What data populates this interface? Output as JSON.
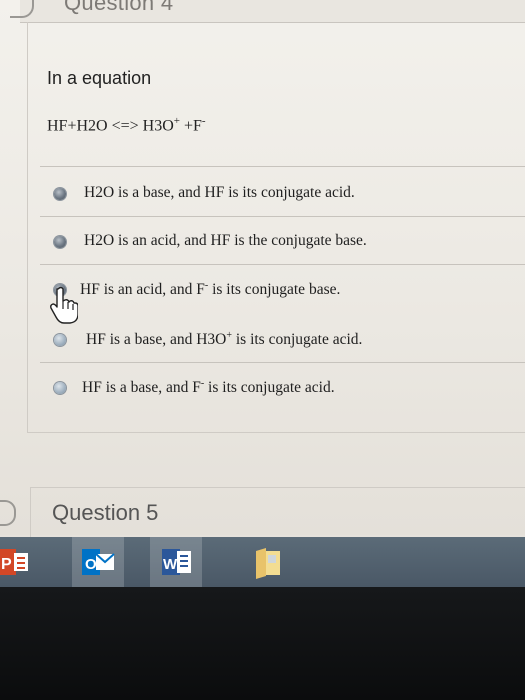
{
  "question4": {
    "title": "Question 4",
    "prompt": "In a equation",
    "equation": {
      "left": "HF+H2O <=> H3O",
      "charge1": "+",
      "mid": " +F",
      "charge2": "-"
    }
  },
  "options": [
    {
      "pre": "H2O is a base, and HF is its conjugate acid.",
      "sup": "",
      "post": ""
    },
    {
      "pre": "H2O is an acid, and HF is the conjugate base.",
      "sup": "",
      "post": ""
    },
    {
      "pre": "HF is an acid, and F",
      "sup": "-",
      "post": " is its conjugate base."
    },
    {
      "pre": "HF is a base, and H3O",
      "sup": "+",
      "post": " is its conjugate acid."
    },
    {
      "pre": "HF is a base, and F",
      "sup": "-",
      "post": " is its conjugate acid."
    }
  ],
  "question5": {
    "title": "Question 5"
  },
  "taskbar": {
    "powerpoint": "P",
    "outlook": "O",
    "word": "W"
  },
  "colors": {
    "taskbar": "#4f5e6b",
    "powerpoint": "#d24726",
    "outlook": "#0072c6",
    "word": "#2b579a"
  }
}
